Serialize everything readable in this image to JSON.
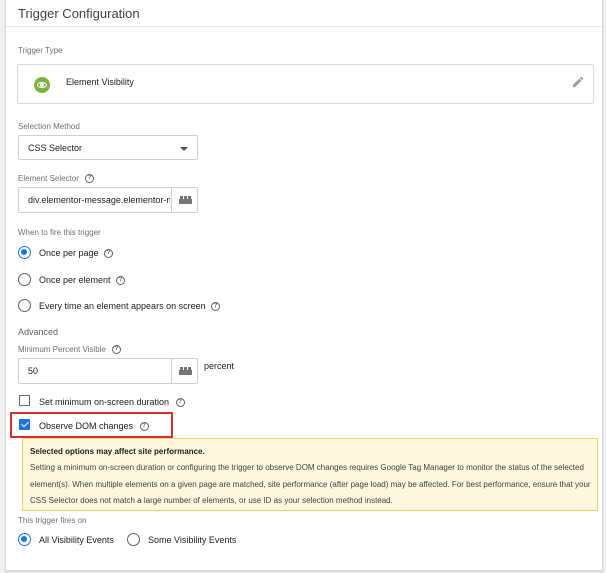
{
  "section_title": "Trigger Configuration",
  "trigger_type": {
    "label": "Trigger Type",
    "value": "Element Visibility",
    "icon": "eye-icon",
    "icon_color": "#7cb342"
  },
  "selection_method": {
    "label": "Selection Method",
    "value": "CSS Selector"
  },
  "element_selector": {
    "label": "Element Selector",
    "value": "div.elementor-message.elementor-message-success"
  },
  "when_to_fire": {
    "label": "When to fire this trigger",
    "options": [
      {
        "label": "Once per page",
        "selected": true
      },
      {
        "label": "Once per element",
        "selected": false
      },
      {
        "label": "Every time an element appears on screen",
        "selected": false
      }
    ]
  },
  "advanced": {
    "label": "Advanced",
    "min_percent_label": "Minimum Percent Visible",
    "min_percent_value": "50",
    "percent_unit": "percent",
    "min_duration_label": "Set minimum on-screen duration",
    "min_duration_checked": false,
    "observe_dom_label": "Observe DOM changes",
    "observe_dom_checked": true
  },
  "warning": {
    "title": "Selected options may affect site performance.",
    "body": "Setting a minimum on-screen duration or configuring the trigger to observe DOM changes requires Google Tag Manager to monitor the status of the selected element(s). When multiple elements on a given page are matched, site performance (after page load) may be affected. For best performance, ensure that your CSS Selector does not match a large number of elements, or use ID as your selection method instead."
  },
  "fires_on": {
    "label": "This trigger fires on",
    "options": [
      {
        "label": "All Visibility Events",
        "selected": true
      },
      {
        "label": "Some Visibility Events",
        "selected": false
      }
    ]
  },
  "colors": {
    "accent": "#1a73e8",
    "highlight": "#d32f2f",
    "warning_bg": "#fef7e0"
  }
}
